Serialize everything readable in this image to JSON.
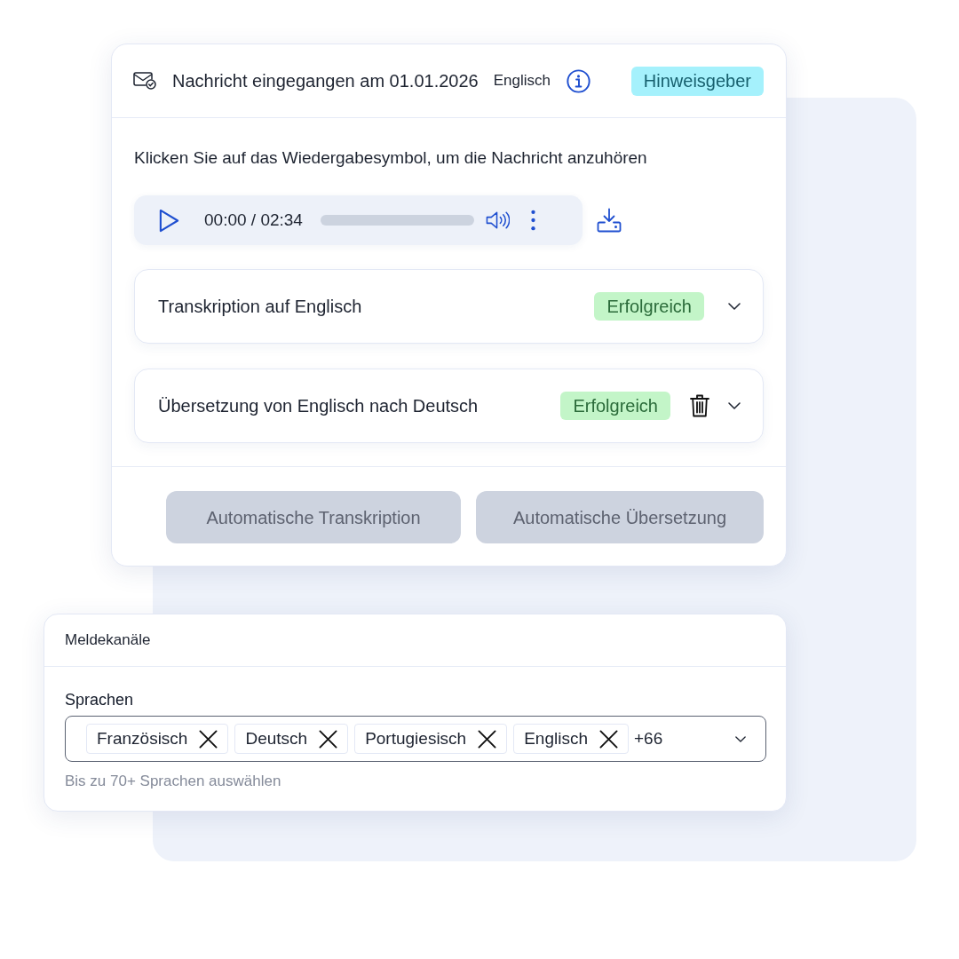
{
  "message_card": {
    "header": {
      "title": "Nachricht eingegangen am 01.01.2026",
      "language": "Englisch",
      "badge": "Hinweisgeber"
    },
    "instruction": "Klicken Sie auf das Wiedergabesymbol, um die Nachricht anzuhören",
    "audio_player": {
      "time": "00:00 / 02:34"
    },
    "sections": [
      {
        "title": "Transkription auf Englisch",
        "status": "Erfolgreich",
        "deletable": false,
        "expanded": false
      },
      {
        "title": "Übersetzung von Englisch nach Deutsch",
        "status": "Erfolgreich",
        "deletable": true,
        "expanded": false
      }
    ],
    "buttons": [
      {
        "label": "Automatische Transkription",
        "disabled": true
      },
      {
        "label": "Automatische Übersetzung",
        "disabled": true
      }
    ]
  },
  "settings_card": {
    "title": "Meldekanäle",
    "field": {
      "label": "Sprachen",
      "chips": [
        "Französisch",
        "Deutsch",
        "Portugiesisch",
        "Englisch"
      ],
      "more": "+66",
      "helper": "Bis zu 70+ Sprachen auswählen"
    }
  }
}
